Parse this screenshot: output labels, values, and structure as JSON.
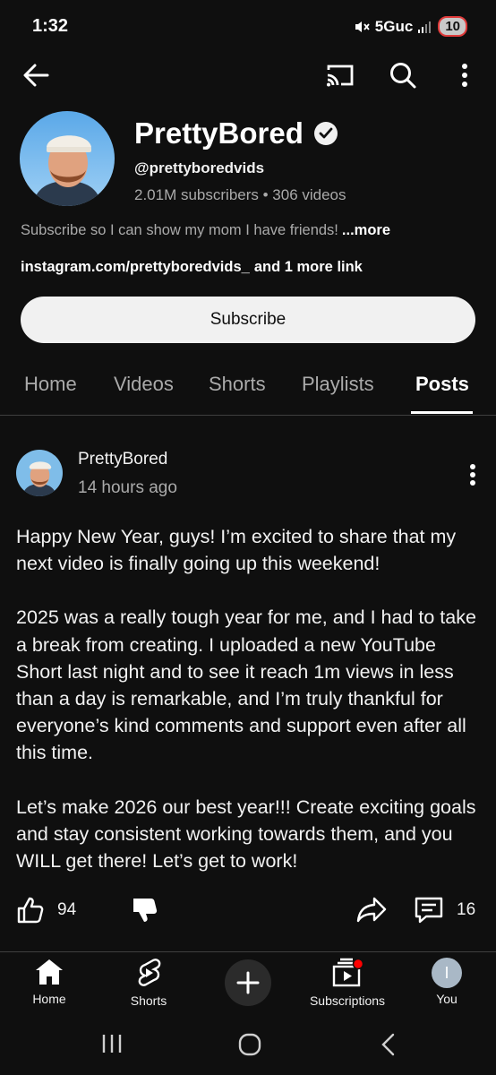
{
  "status_bar": {
    "time": "1:32",
    "network": "5Guc",
    "battery": "10"
  },
  "top_bar": {
    "icons": [
      "back-arrow-icon",
      "cast-icon",
      "search-icon",
      "more-vert-icon"
    ]
  },
  "channel": {
    "name": "PrettyBored",
    "handle": "@prettyboredvids",
    "stats": "2.01M subscribers • 306 videos",
    "description": "Subscribe so I can show my mom I have friends!",
    "description_more": "...more",
    "link_text": "instagram.com/prettyboredvids_",
    "more_links": "and 1 more link",
    "subscribe_label": "Subscribe"
  },
  "tabs": [
    {
      "label": "Home"
    },
    {
      "label": "Videos"
    },
    {
      "label": "Shorts"
    },
    {
      "label": "Playlists"
    },
    {
      "label": "Posts"
    }
  ],
  "active_tab": "Posts",
  "post": {
    "author": "PrettyBored",
    "time": "14 hours ago",
    "paragraphs": [
      "Happy New Year, guys! I’m excited to share that my next video is finally going up this weekend!",
      "2025 was a really tough year for me, and I had to take a break from creating. I uploaded a new YouTube Short last night and to see it reach 1m views in less than a day is remarkable, and I’m truly thankful for everyone’s kind comments and support even after all this time.",
      "Let’s make 2026 our best year!!! Create exciting goals and stay consistent working towards them, and you WILL get there! Let’s get to work!"
    ],
    "likes": "94",
    "comments": "16"
  },
  "bottom_nav": {
    "home": "Home",
    "shorts": "Shorts",
    "subscriptions": "Subscriptions",
    "you": "You",
    "you_initial": "I"
  },
  "colors": {
    "background": "#0f0f0f",
    "text_primary": "#f1f1f1",
    "text_secondary": "#aaaaaa",
    "notification": "#ff0000"
  }
}
